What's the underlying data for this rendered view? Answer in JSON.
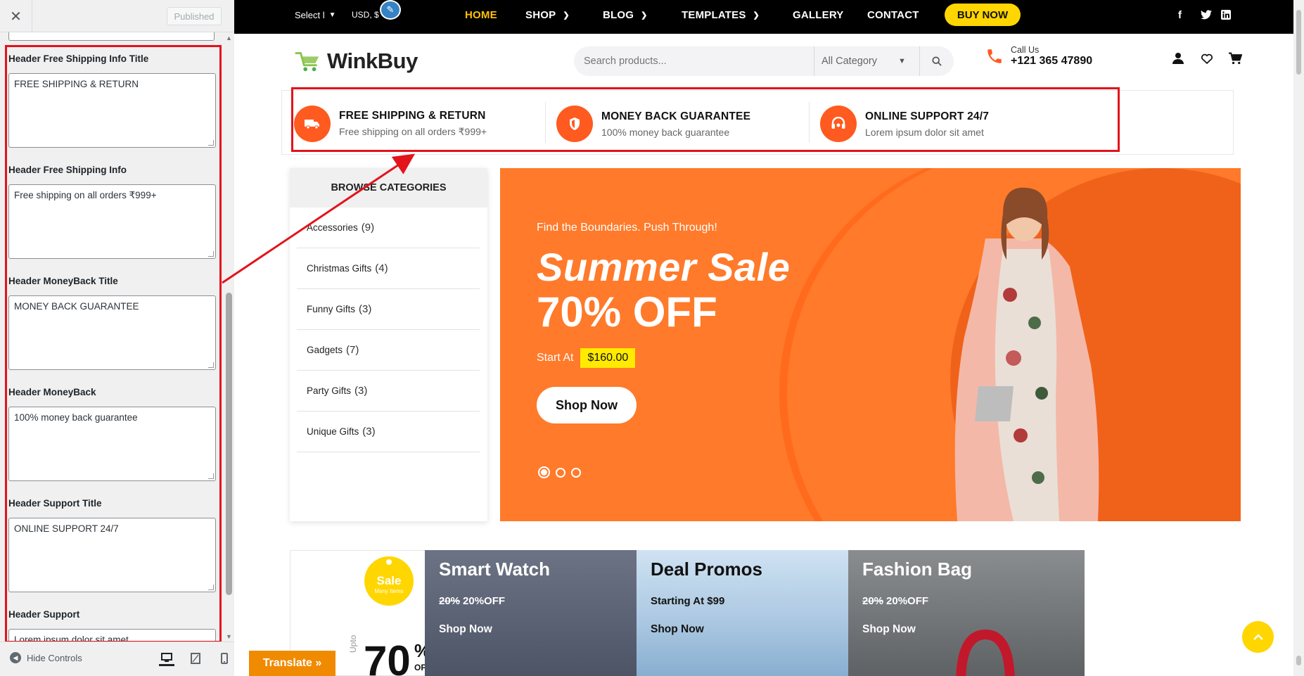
{
  "panel": {
    "close_icon": "close-icon",
    "published_label": "Published",
    "fields": [
      {
        "label": "Header Free Shipping Info Title",
        "value": "FREE SHIPPING & RETURN"
      },
      {
        "label": "Header Free Shipping Info",
        "value": "Free shipping on all orders ₹999+"
      },
      {
        "label": "Header MoneyBack Title",
        "value": "MONEY BACK GUARANTEE"
      },
      {
        "label": "Header MoneyBack",
        "value": "100% money back guarantee"
      },
      {
        "label": "Header Support Title",
        "value": "ONLINE SUPPORT 24/7"
      },
      {
        "label": "Header Support",
        "value": "Lorem ipsum dolor sit amet"
      }
    ],
    "hide_controls_label": "Hide Controls",
    "devices": [
      "desktop-icon",
      "tablet-icon",
      "mobile-icon"
    ]
  },
  "topbar": {
    "select_label": "Select l",
    "currency": "USD, $",
    "nav": [
      "HOME",
      "SHOP",
      "BLOG",
      "TEMPLATES",
      "GALLERY",
      "CONTACT"
    ],
    "active": "HOME",
    "buy_now": "BUY NOW",
    "social": [
      "f",
      "t",
      "in"
    ]
  },
  "header": {
    "logo_text": "WinkBuy",
    "search_placeholder": "Search products...",
    "category_select": "All Category",
    "call_label": "Call Us",
    "call_number": "+121 365 47890"
  },
  "features": [
    {
      "title": "FREE SHIPPING & RETURN",
      "sub": "Free shipping on all orders ₹999+",
      "icon": "truck-icon"
    },
    {
      "title": "MONEY BACK GUARANTEE",
      "sub": "100% money back guarantee",
      "icon": "shield-icon"
    },
    {
      "title": "ONLINE SUPPORT 24/7",
      "sub": "Lorem ipsum dolor sit amet",
      "icon": "headset-icon"
    }
  ],
  "categories": {
    "heading": "BROWSE CATEGORIES",
    "items": [
      {
        "name": "Accessories",
        "count": "(9)"
      },
      {
        "name": "Christmas Gifts",
        "count": "(4)"
      },
      {
        "name": "Funny Gifts",
        "count": "(3)"
      },
      {
        "name": "Gadgets",
        "count": "(7)"
      },
      {
        "name": "Party Gifts",
        "count": "(3)"
      },
      {
        "name": "Unique Gifts",
        "count": "(3)"
      }
    ]
  },
  "hero": {
    "subtitle": "Find the Boundaries. Push Through!",
    "title": "Summer Sale",
    "offer": "70% OFF",
    "start_label": "Start At",
    "price": "$160.00",
    "button": "Shop Now",
    "slides": 3,
    "active_slide": 1
  },
  "promos": {
    "sale_badge": "Sale",
    "sale_badge_sub": "Many Items",
    "upto": "Upto",
    "big_num": "70",
    "pct": "%",
    "off": "OFF",
    "cards": [
      {
        "title": "Smart Watch",
        "old": "20%",
        "new": "20%OFF",
        "link": "Shop Now",
        "bg": "#6c7384"
      },
      {
        "title": "Deal Promos",
        "old": "",
        "new": "Starting At $99",
        "link": "Shop Now",
        "bg": "#a9c6e0"
      },
      {
        "title": "Fashion Bag",
        "old": "20%",
        "new": "20%OFF",
        "link": "Shop Now",
        "bg": "#7b7d7f"
      }
    ]
  },
  "translate_label": "Translate »",
  "colors": {
    "accent": "#ff5a1f",
    "hero": "#ff7a2a",
    "highlight": "#e3131b",
    "yellow": "#ffd600"
  }
}
